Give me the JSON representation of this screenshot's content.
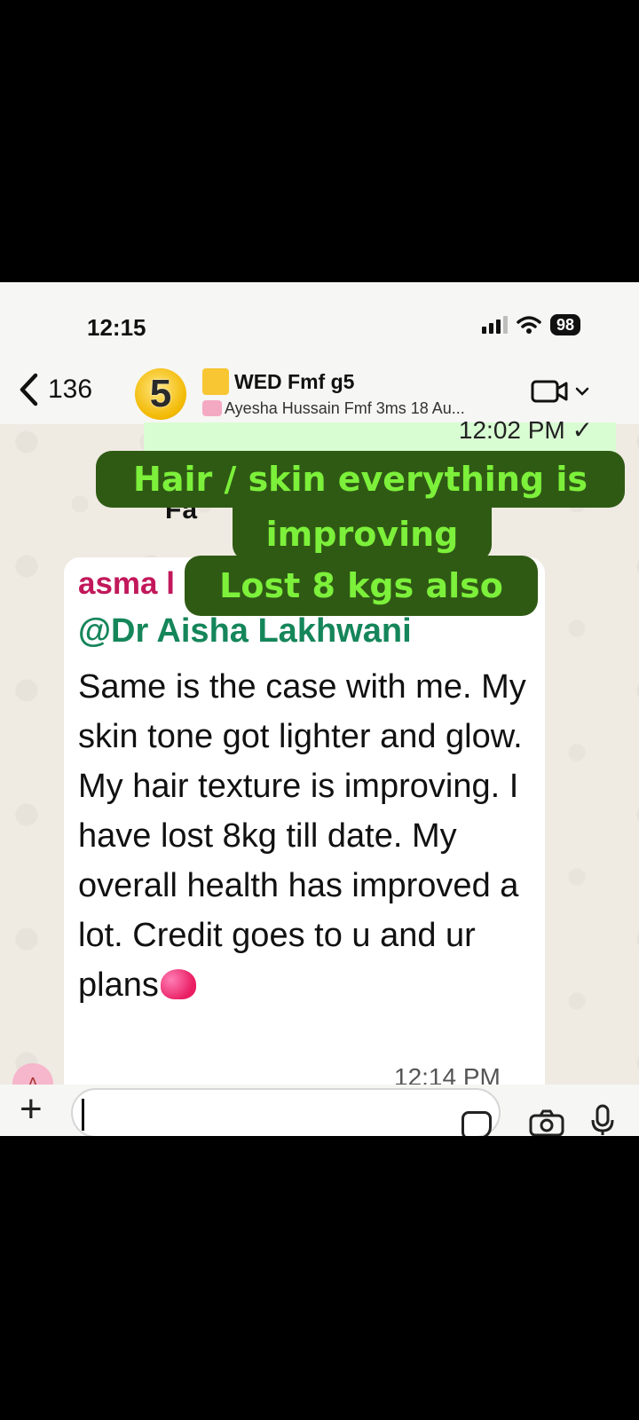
{
  "status_bar": {
    "time": "12:15",
    "battery": "98"
  },
  "header": {
    "back_count": "136",
    "avatar_number": "5",
    "group_name": "WED Fmf g5",
    "subtitle": "Ayesha Hussain Fmf 3ms  18 Au..."
  },
  "messages": {
    "outgoing_time": "12:02 PM ✓",
    "partial_text": "Fa",
    "incoming": {
      "sender": "asma l",
      "mention": "@Dr Aisha Lakhwani",
      "body": "Same is the case with me. My skin tone got lighter and glow. My hair texture is improving. I have lost 8kg till date. My overall health has improved a lot. Credit goes to u and ur plans",
      "time": "12:14 PM",
      "avatar_letter": "A"
    }
  },
  "overlay_captions": {
    "line1": "Hair / skin everything is",
    "line2": "improving",
    "line3": "Lost 8 kgs also"
  },
  "colors": {
    "caption_bg": "#2f5a14",
    "caption_text": "#7cf03a",
    "sender": "#c2185b",
    "mention": "#15865a"
  }
}
